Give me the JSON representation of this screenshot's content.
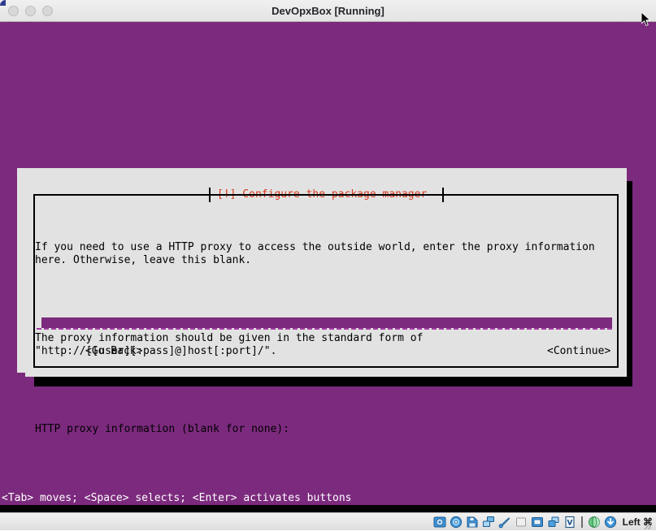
{
  "window": {
    "title": "DevOpxBox [Running]",
    "traffic_lights": [
      "close",
      "minimize",
      "zoom"
    ]
  },
  "dialog": {
    "title": "[!] Configure the package manager",
    "title_color": "#d63b1f",
    "background": "#e2e2e2",
    "paragraphs": [
      "If you need to use a HTTP proxy to access the outside world, enter the proxy information\nhere. Otherwise, leave this blank.",
      "The proxy information should be given in the standard form of\n\"http://[[user][:pass]@]host[:port]/\".",
      "HTTP proxy information (blank for none):"
    ],
    "input": {
      "value": "",
      "placeholder": "",
      "fill_color": "#7c2a7e"
    },
    "buttons": {
      "go_back": "<Go Back>",
      "continue": "<Continue>"
    }
  },
  "console": {
    "background": "#7c2a7e",
    "help_line": "<Tab> moves; <Space> selects; <Enter> activates buttons"
  },
  "statusbar": {
    "host_key": "Left ⌘",
    "icons": [
      "hard-disk-icon",
      "optical-disk-icon",
      "floppy-disk-icon",
      "network-icon",
      "usb-icon",
      "shared-folders-icon",
      "display-icon",
      "recording-icon",
      "virtualization-icon",
      "mouse-integration-icon",
      "host-key-icon"
    ]
  }
}
